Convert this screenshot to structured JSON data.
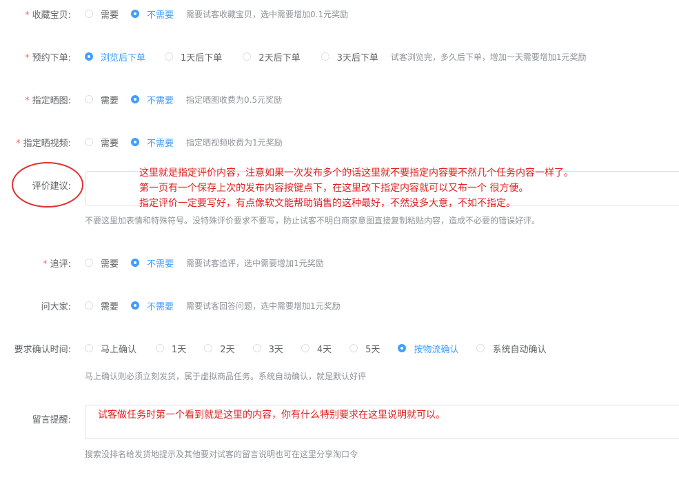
{
  "fields": {
    "collect": {
      "label": "收藏宝贝:",
      "options": [
        "需要",
        "不需要"
      ],
      "tip": "需要试客收藏宝贝，选中需要增加0.1元奖励"
    },
    "reserve": {
      "label": "预约下单:",
      "options": [
        "浏览后下单",
        "1天后下单",
        "2天后下单",
        "3天后下单"
      ],
      "tip": "试客浏览完，多久后下单，增加一天需要增加1元奖励"
    },
    "photo": {
      "label": "指定晒图:",
      "options": [
        "需要",
        "不需要"
      ],
      "tip": "指定晒图收费为0.5元奖励"
    },
    "video": {
      "label": "指定晒视频:",
      "options": [
        "需要",
        "不需要"
      ],
      "tip": "指定晒视频收费为1元奖励"
    },
    "review": {
      "label": "评价建议:",
      "hint": "不要这里加表情和特殊符号。没特殊评价要求不要写，防止试客不明白商家意图直接复制粘贴内容，造成不必要的错误好评。"
    },
    "followup": {
      "label": "追评:",
      "options": [
        "需要",
        "不需要"
      ],
      "tip": "需要试客追评，选中需要增加1元奖励"
    },
    "ask": {
      "label": "问大家:",
      "options": [
        "需要",
        "不需要"
      ],
      "tip": "需要试客回答问题，选中需要增加1元奖励"
    },
    "confirm": {
      "label": "要求确认时间:",
      "options": [
        "马上确认",
        "1天",
        "2天",
        "3天",
        "4天",
        "5天",
        "按物流确认",
        "系统自动确认"
      ],
      "hint": "马上确认则必须立刻发货，属于虚拟商品任务。系统自动确认，就是默认好评"
    },
    "message": {
      "label": "留言提醒:",
      "hint": "搜索没排名给发货地提示及其他要对试客的留言说明也可在这里分享淘口令"
    }
  },
  "annotations": {
    "review_line1": "这里就是指定评价内容，注意如果一次发布多个的话这里就不要指定内容要不然几个任务内容一样了。",
    "review_line2": "第一页有一个保存上次的发布内容按键点下，在这里改下指定内容就可以又布一个 很方便。",
    "review_line3": "指定评价一定要写好，有点像软文能帮助销售的这种最好，不然没多大意，不如不指定。",
    "message_note": "试客做任务时第一个看到就是这里的内容，你有什么特别要求在这里说明就可以。"
  },
  "colors": {
    "accent": "#409eff",
    "required": "#f56c6c",
    "annotation": "#e02020"
  }
}
